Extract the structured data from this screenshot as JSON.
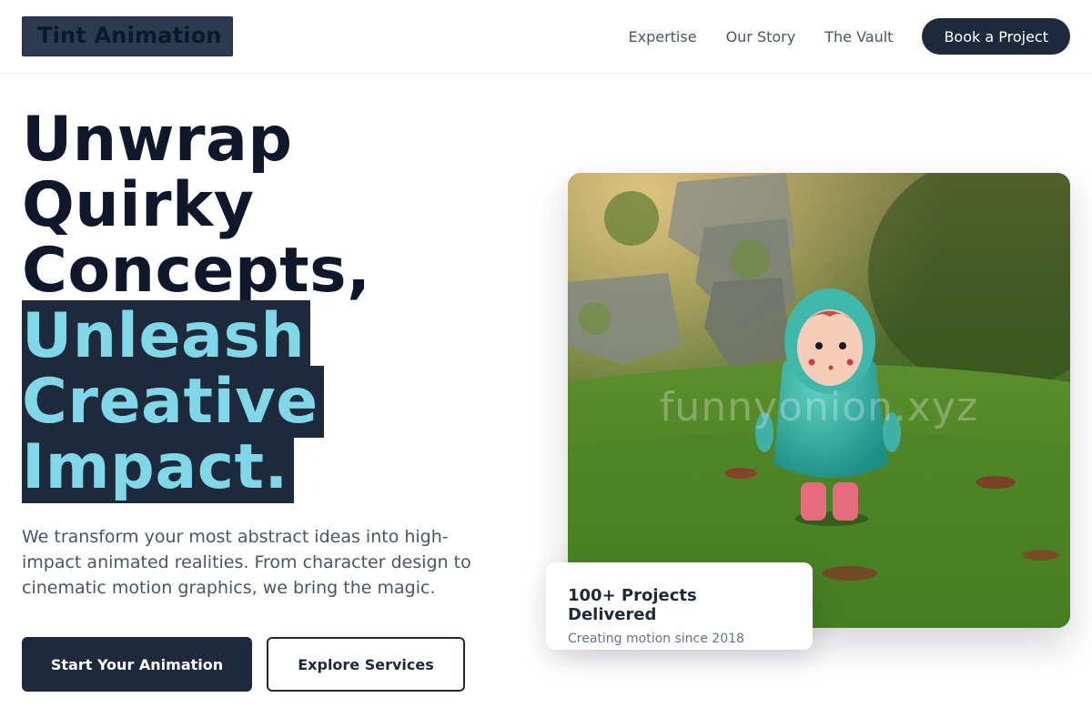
{
  "header": {
    "logo_text": "Tint Animation",
    "nav": [
      "Expertise",
      "Our Story",
      "The Vault"
    ],
    "cta_label": "Book a Project"
  },
  "hero": {
    "title_lines": [
      "Unwrap",
      "Quirky",
      "Concepts,"
    ],
    "highlight_lines": [
      "Unleash",
      "Creative",
      "Impact."
    ],
    "description": "We transform your most abstract ideas into high-impact animated realities. From character design to cinematic motion graphics, we bring the magic.",
    "primary_button": "Start Your Animation",
    "secondary_button": "Explore Services"
  },
  "image": {
    "watermark": "funnyonion.xyz"
  },
  "stat_card": {
    "title": "100+ Projects Delivered",
    "subtitle": "Creating motion since 2018"
  },
  "colors": {
    "primary": "#1e293b",
    "accent": "#7fd7e8",
    "text_muted": "#4a5566"
  }
}
